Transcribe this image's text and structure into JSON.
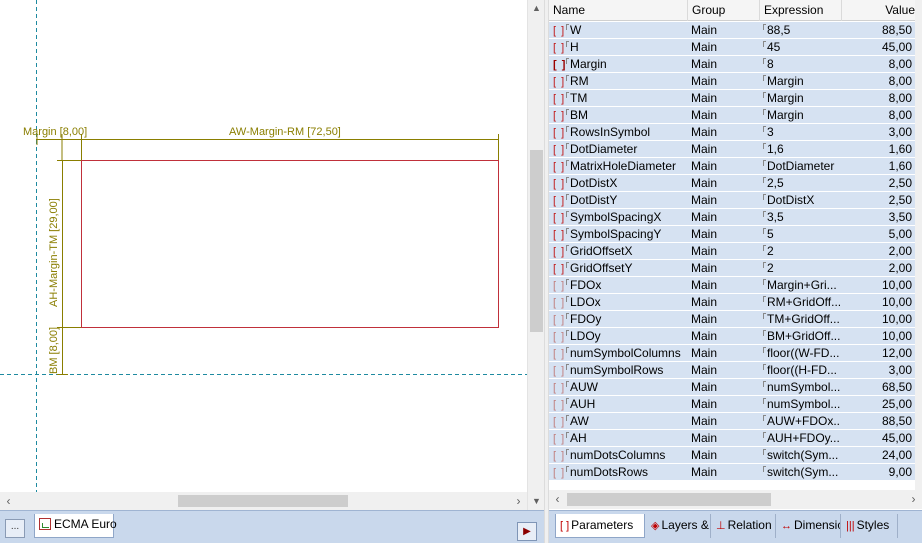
{
  "canvas": {
    "dim_margin": "Margin [8,00]",
    "dim_width": "AW-Margin-RM [72,50]",
    "dim_height": "AH-Margin-TM [29,00]",
    "dim_bm": "BM [8,00]",
    "colors": {
      "guide": "#1e8aa0",
      "dimension": "#8a7e00",
      "shape": "#c0303a"
    }
  },
  "left_tabs": {
    "more_label": "...",
    "document_tab": "ECMA Euro",
    "next_arrow": "▶"
  },
  "grid": {
    "columns": [
      "Name",
      "Group",
      "Expression",
      "Value"
    ],
    "rows": [
      {
        "bracket": "[ ]",
        "name": "W",
        "group": "Main",
        "expr": "88,5",
        "value": "88,50"
      },
      {
        "bracket": "[ ]",
        "name": "H",
        "group": "Main",
        "expr": "45",
        "value": "45,00"
      },
      {
        "bracket": "[ ]",
        "name": "Margin",
        "group": "Main",
        "expr": "8",
        "value": "8,00",
        "bold": true
      },
      {
        "bracket": "[ ]",
        "name": "RM",
        "group": "Main",
        "expr": "Margin",
        "value": "8,00"
      },
      {
        "bracket": "[ ]",
        "name": "TM",
        "group": "Main",
        "expr": "Margin",
        "value": "8,00"
      },
      {
        "bracket": "[ ]",
        "name": "BM",
        "group": "Main",
        "expr": "Margin",
        "value": "8,00"
      },
      {
        "bracket": "[ ]",
        "name": "RowsInSymbol",
        "group": "Main",
        "expr": "3",
        "value": "3,00"
      },
      {
        "bracket": "[ ]",
        "name": "DotDiameter",
        "group": "Main",
        "expr": "1,6",
        "value": "1,60"
      },
      {
        "bracket": "[ ]",
        "name": "MatrixHoleDiameter",
        "group": "Main",
        "expr": "DotDiameter",
        "value": "1,60"
      },
      {
        "bracket": "[ ]",
        "name": "DotDistX",
        "group": "Main",
        "expr": "2,5",
        "value": "2,50"
      },
      {
        "bracket": "[ ]",
        "name": "DotDistY",
        "group": "Main",
        "expr": "DotDistX",
        "value": "2,50"
      },
      {
        "bracket": "[ ]",
        "name": "SymbolSpacingX",
        "group": "Main",
        "expr": "3,5",
        "value": "3,50"
      },
      {
        "bracket": "[ ]",
        "name": "SymbolSpacingY",
        "group": "Main",
        "expr": "5",
        "value": "5,00"
      },
      {
        "bracket": "[ ]",
        "name": "GridOffsetX",
        "group": "Main",
        "expr": "2",
        "value": "2,00"
      },
      {
        "bracket": "[ ]",
        "name": "GridOffsetY",
        "group": "Main",
        "expr": "2",
        "value": "2,00"
      },
      {
        "bracket": "[ ]",
        "name": "FDOx",
        "group": "Main",
        "expr": "Margin+Gri...",
        "value": "10,00",
        "faint": true
      },
      {
        "bracket": "[ ]",
        "name": "LDOx",
        "group": "Main",
        "expr": "RM+GridOff...",
        "value": "10,00",
        "faint": true
      },
      {
        "bracket": "[ ]",
        "name": "FDOy",
        "group": "Main",
        "expr": "TM+GridOff...",
        "value": "10,00",
        "faint": true
      },
      {
        "bracket": "[ ]",
        "name": "LDOy",
        "group": "Main",
        "expr": "BM+GridOff...",
        "value": "10,00",
        "faint": true
      },
      {
        "bracket": "[ ]",
        "name": "numSymbolColumns",
        "group": "Main",
        "expr": "floor((W-FD...",
        "value": "12,00",
        "faint": true
      },
      {
        "bracket": "[ ]",
        "name": "numSymbolRows",
        "group": "Main",
        "expr": "floor((H-FD...",
        "value": "3,00",
        "faint": true
      },
      {
        "bracket": "[ ]",
        "name": "AUW",
        "group": "Main",
        "expr": "numSymbol...",
        "value": "68,50",
        "faint": true
      },
      {
        "bracket": "[ ]",
        "name": "AUH",
        "group": "Main",
        "expr": "numSymbol...",
        "value": "25,00",
        "faint": true
      },
      {
        "bracket": "[ ]",
        "name": "AW",
        "group": "Main",
        "expr": "AUW+FDOx...",
        "value": "88,50",
        "faint": true
      },
      {
        "bracket": "[ ]",
        "name": "AH",
        "group": "Main",
        "expr": "AUH+FDOy...",
        "value": "45,00",
        "faint": true
      },
      {
        "bracket": "[ ]",
        "name": "numDotsColumns",
        "group": "Main",
        "expr": "switch(Sym...",
        "value": "24,00",
        "faint": true
      },
      {
        "bracket": "[ ]",
        "name": "numDotsRows",
        "group": "Main",
        "expr": "switch(Sym...",
        "value": "9,00",
        "faint": true
      }
    ]
  },
  "right_tabs": [
    {
      "icon": "[ ]",
      "label": "Parameters",
      "icon_name": "parameters-icon"
    },
    {
      "icon": "◈",
      "label": "Layers &",
      "icon_name": "layers-icon"
    },
    {
      "icon": "⊥",
      "label": "Relation",
      "icon_name": "relation-icon"
    },
    {
      "icon": "↔",
      "label": "Dimensic",
      "icon_name": "dimension-icon"
    },
    {
      "icon": "|||",
      "label": "Styles",
      "icon_name": "styles-icon"
    }
  ]
}
